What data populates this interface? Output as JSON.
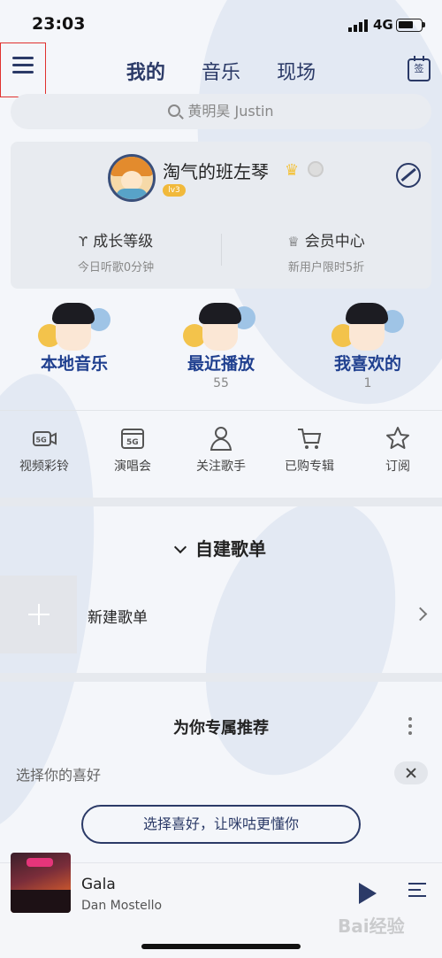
{
  "status_bar": {
    "time": "23:03",
    "network": "4G"
  },
  "top_nav": {
    "tabs": [
      {
        "label": "我的",
        "active": true
      },
      {
        "label": "音乐",
        "active": false
      },
      {
        "label": "现场",
        "active": false
      }
    ],
    "sign_in_icon_label": "签"
  },
  "search": {
    "placeholder": "黄明昊 Justin"
  },
  "profile": {
    "username": "淘气的班左琴",
    "level_badge": "lv3",
    "growth": {
      "title": "成长等级",
      "subtitle": "今日听歌0分钟"
    },
    "vip": {
      "title": "会员中心",
      "subtitle": "新用户限时5折"
    }
  },
  "quick_access": [
    {
      "label": "本地音乐",
      "count": ""
    },
    {
      "label": "最近播放",
      "count": "55"
    },
    {
      "label": "我喜欢的",
      "count": "1"
    }
  ],
  "feature_grid": [
    {
      "label": "视频彩铃",
      "icon": "video-5g-icon"
    },
    {
      "label": "演唱会",
      "icon": "concert-5g-icon"
    },
    {
      "label": "关注歌手",
      "icon": "user-follow-icon"
    },
    {
      "label": "已购专辑",
      "icon": "cart-icon"
    },
    {
      "label": "订阅",
      "icon": "star-icon"
    }
  ],
  "playlists": {
    "section_title": "自建歌单",
    "new_playlist_label": "新建歌单"
  },
  "recommendation": {
    "title": "为你专属推荐",
    "preference_label": "选择你的喜好",
    "preference_button": "选择喜好，让咪咕更懂你"
  },
  "now_playing": {
    "title": "Gala",
    "artist": "Dan Mostello"
  },
  "watermark": "Bai经验",
  "colors": {
    "accent": "#2b3a67",
    "highlight_box": "#e0312e",
    "brand_blue": "#1f3f8f",
    "badge": "#f1b93b"
  }
}
